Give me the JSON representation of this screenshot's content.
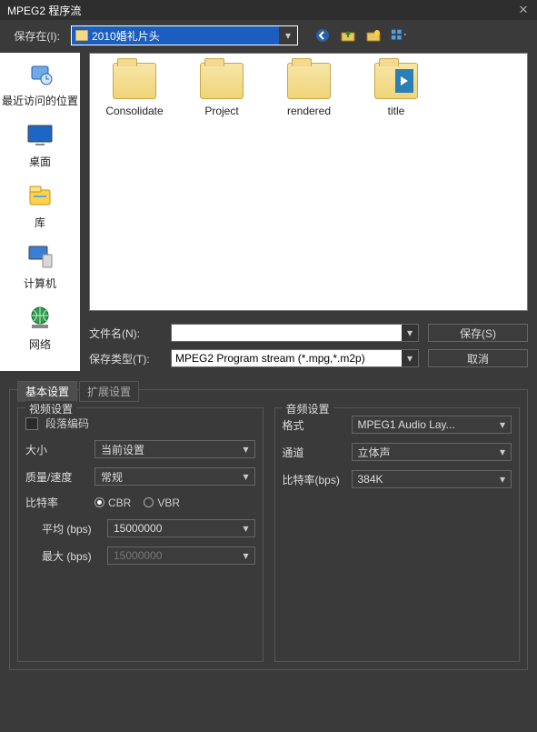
{
  "window": {
    "title": "MPEG2 程序流"
  },
  "toolbar": {
    "saveInLabel": "保存在(I):",
    "currentFolder": "2010婚礼片头"
  },
  "places": [
    {
      "key": "recent",
      "label": "最近访问的位置"
    },
    {
      "key": "desktop",
      "label": "桌面"
    },
    {
      "key": "library",
      "label": "库"
    },
    {
      "key": "computer",
      "label": "计算机"
    },
    {
      "key": "network",
      "label": "网络"
    }
  ],
  "folders": [
    {
      "label": "Consolidate"
    },
    {
      "label": "Project"
    },
    {
      "label": "rendered"
    },
    {
      "label": "title"
    }
  ],
  "form": {
    "fileNameLabel": "文件名(N):",
    "fileNameValue": "",
    "fileTypeLabel": "保存类型(T):",
    "fileTypeValue": "MPEG2 Program stream (*.mpg,*.m2p)",
    "saveBtn": "保存(S)",
    "cancelBtn": "取消"
  },
  "tabs": {
    "basic": "基本设置",
    "advanced": "扩展设置"
  },
  "video": {
    "panelTitle": "视频设置",
    "segmentLabel": "段落编码",
    "sizeLabel": "大小",
    "sizeValue": "当前设置",
    "qualityLabel": "质量/速度",
    "qualityValue": "常规",
    "bitrateLabel": "比特率",
    "cbrLabel": "CBR",
    "vbrLabel": "VBR",
    "avgLabel": "平均 (bps)",
    "avgValue": "15000000",
    "maxLabel": "最大 (bps)",
    "maxValue": "15000000"
  },
  "audio": {
    "panelTitle": "音频设置",
    "formatLabel": "格式",
    "formatValue": "MPEG1 Audio Lay...",
    "channelLabel": "通道",
    "channelValue": "立体声",
    "bitrateLabel": "比特率(bps)",
    "bitrateValue": "384K"
  }
}
